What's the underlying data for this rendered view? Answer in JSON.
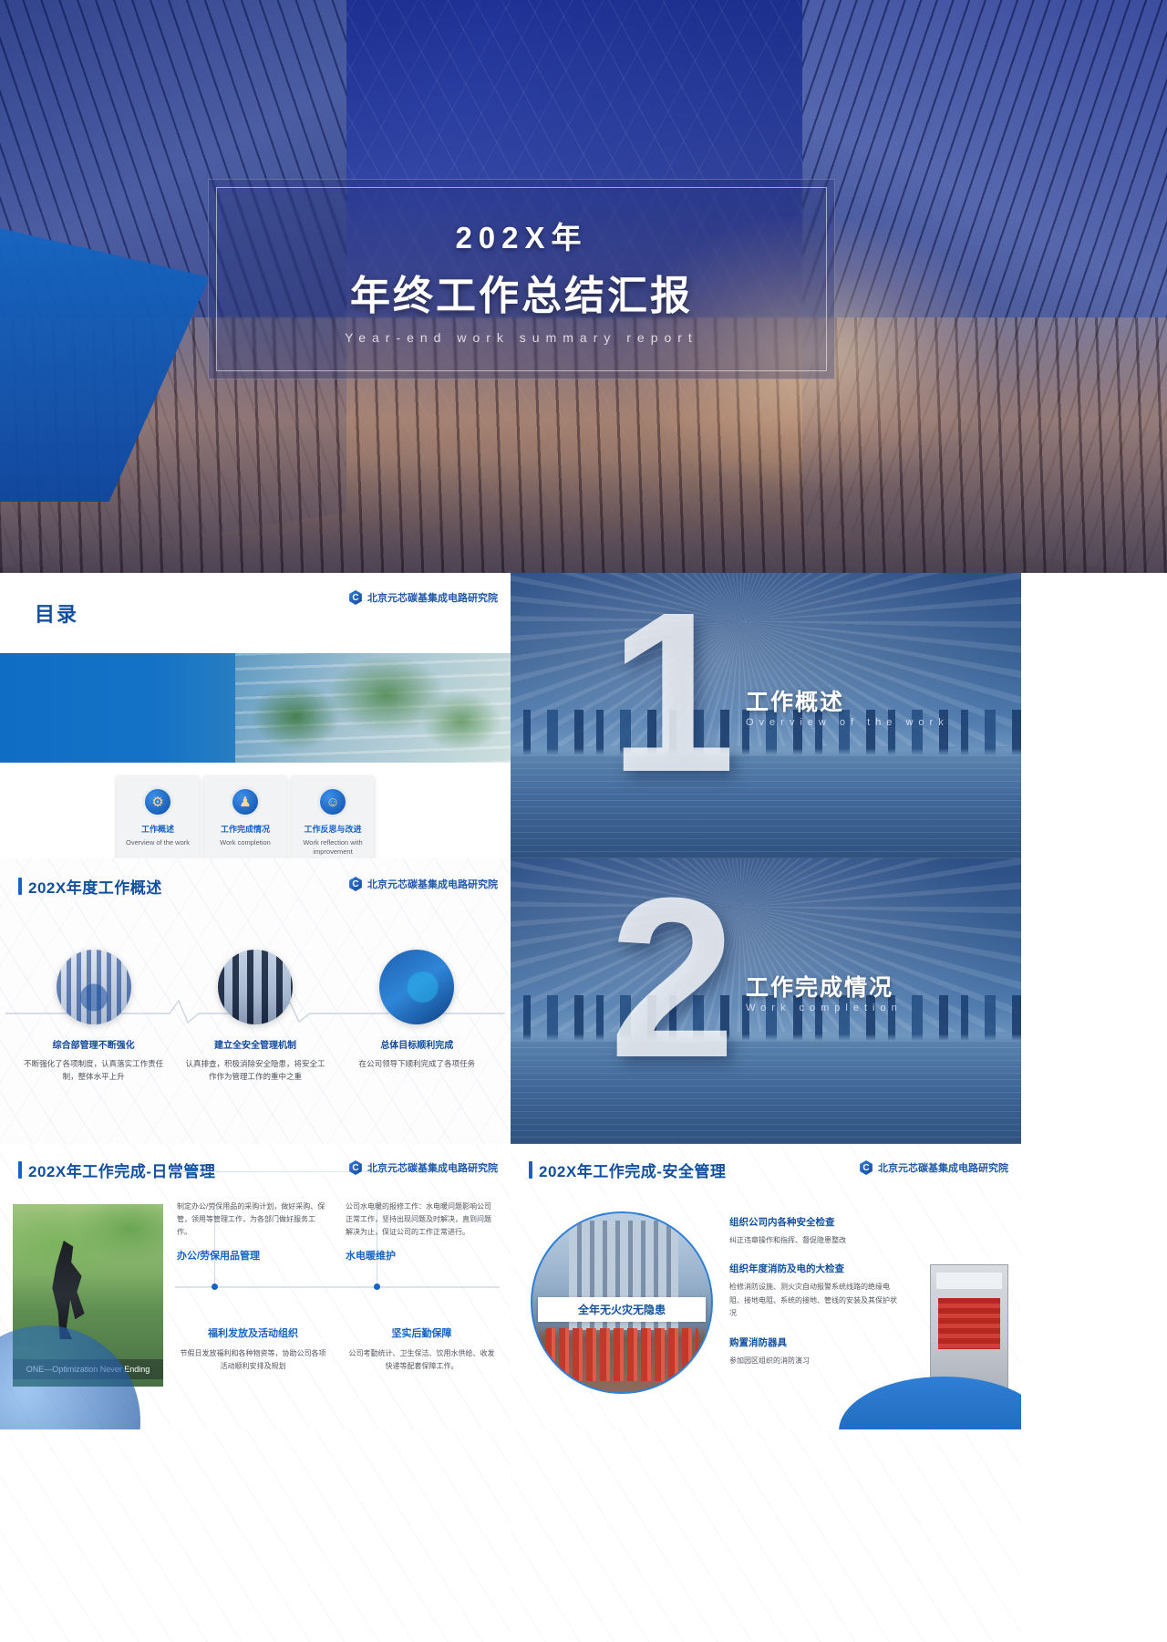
{
  "title_slide": {
    "year": "202X年",
    "main_title": "年终工作总结汇报",
    "subtitle_en": "Year-end work summary report"
  },
  "brand": {
    "icon": "c-badge-icon",
    "name": "北京元芯碳基集成电路研究院"
  },
  "contents_slide": {
    "heading": "目录",
    "cards": [
      {
        "title": "工作概述",
        "subtitle": "Overview of the work"
      },
      {
        "title": "工作完成情况",
        "subtitle": "Work completion"
      },
      {
        "title": "工作反思与改进",
        "subtitle": "Work reflection with improvement"
      }
    ]
  },
  "section_1": {
    "number": "1",
    "title": "工作概述",
    "subtitle_en": "Overview of the work"
  },
  "section_2": {
    "number": "2",
    "title": "工作完成情况",
    "subtitle_en": "Work completion"
  },
  "overview_slide": {
    "heading": "202X年度工作概述",
    "columns": [
      {
        "title": "综合部管理不断强化",
        "desc": "不断强化了各项制度，认真落实工作责任制，整体水平上升"
      },
      {
        "title": "建立全安全管理机制",
        "desc": "认真排查，积极消除安全隐患，将安全工作作为管理工作的重中之重"
      },
      {
        "title": "总体目标顺利完成",
        "desc": "在公司领导下顺利完成了各项任务"
      }
    ]
  },
  "daily_mgmt_slide": {
    "heading": "202X年工作完成-日常管理",
    "photo_caption": "ONE—Optimization Never Ending",
    "items": [
      {
        "label": "办公/劳保用品管理",
        "body": "制定办公/劳保用品的采购计划，做好采购、保管，领用等管理工作，为各部门做好服务工作。"
      },
      {
        "label": "水电暖维护",
        "body": "公司水电暖的报修工作：水电暖问题影响公司正常工作，坚持出现问题及时解决，直到问题解决为止，保证公司的工作正常进行。"
      },
      {
        "label": "福利发放及活动组织",
        "body": "节假日发放福利和各种物资等，协助公司各项活动顺利安排及规划"
      },
      {
        "label": "坚实后勤保障",
        "body": "公司考勤统计、卫生保洁、饮用水供给、收发快递等配套保障工作。"
      }
    ]
  },
  "safety_mgmt_slide": {
    "heading": "202X年工作完成-安全管理",
    "banner": "全年无火灾无隐患",
    "items": [
      {
        "title": "组织公司内各种安全检查",
        "body": "纠正违章操作和指挥、督促隐患整改"
      },
      {
        "title": "组织年度消防及电的大检查",
        "body": "检修消防设施、测火灾自动报警系统线路的绝缘电阻、接地电阻、系统的接地、管线的安装及其保护状况"
      },
      {
        "title": "购置消防器具",
        "body": "参加园区组织的消防演习"
      }
    ]
  }
}
